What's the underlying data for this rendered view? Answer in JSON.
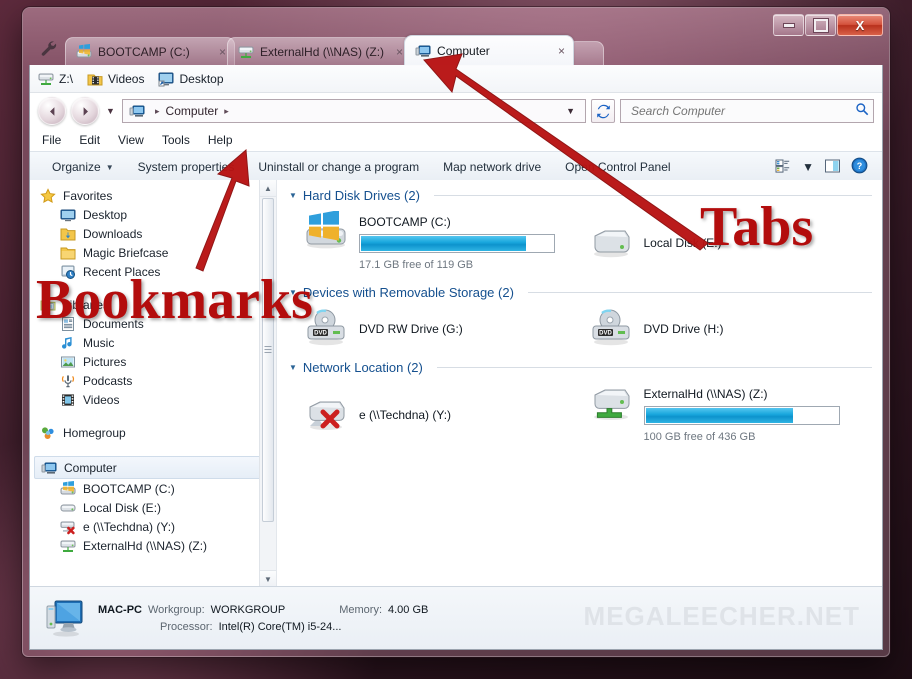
{
  "window": {
    "controls": {
      "minimize": "–",
      "maximize": "□",
      "close": "X"
    },
    "settings_icon": "wrench-icon"
  },
  "tabs": [
    {
      "label": "BOOTCAMP (C:)",
      "icon": "windows-drive-icon",
      "active": false,
      "close": "×"
    },
    {
      "label": "ExternalHd (\\\\NAS) (Z:)",
      "icon": "network-drive-icon",
      "active": false,
      "close": "×"
    },
    {
      "label": "Computer",
      "icon": "computer-icon",
      "active": true,
      "close": "×"
    }
  ],
  "bookmarks": [
    {
      "label": "Z:\\",
      "icon": "network-drive-icon"
    },
    {
      "label": "Videos",
      "icon": "videos-folder-icon"
    },
    {
      "label": "Desktop",
      "icon": "desktop-shortcut-icon"
    }
  ],
  "navigation": {
    "back": "◀",
    "forward": "▶",
    "history_dropdown": "▼",
    "breadcrumb": {
      "icon": "computer-icon",
      "root_sep": "▸",
      "path": "Computer",
      "trailing_sep": "▸",
      "dropdown": "▼"
    },
    "refresh": "↻",
    "refresh_icon": "refresh-icon"
  },
  "search": {
    "placeholder": "Search Computer",
    "value": "",
    "icon": "search-icon"
  },
  "menu": [
    "File",
    "Edit",
    "View",
    "Tools",
    "Help"
  ],
  "commandbar": {
    "items": [
      "Organize",
      "System properties",
      "Uninstall or change a program",
      "Map network drive",
      "Open Control Panel"
    ],
    "organize_caret": "▼",
    "view_caret": "▼",
    "icons": [
      "view-options-icon",
      "preview-pane-icon",
      "help-icon"
    ]
  },
  "sidebar": {
    "groups": [
      {
        "header": {
          "label": "Favorites",
          "icon": "favorites-star-icon"
        },
        "items": [
          {
            "label": "Desktop",
            "icon": "desktop-icon"
          },
          {
            "label": "Downloads",
            "icon": "downloads-folder-icon"
          },
          {
            "label": "Magic Briefcase",
            "icon": "folder-icon"
          },
          {
            "label": "Recent Places",
            "icon": "recent-places-icon"
          }
        ]
      },
      {
        "header": {
          "label": "Libraries",
          "icon": "libraries-icon"
        },
        "items": [
          {
            "label": "Documents",
            "icon": "documents-library-icon"
          },
          {
            "label": "Music",
            "icon": "music-library-icon"
          },
          {
            "label": "Pictures",
            "icon": "pictures-library-icon"
          },
          {
            "label": "Podcasts",
            "icon": "podcasts-library-icon"
          },
          {
            "label": "Videos",
            "icon": "videos-library-icon"
          }
        ]
      },
      {
        "header": {
          "label": "Homegroup",
          "icon": "homegroup-icon"
        },
        "items": []
      },
      {
        "header": {
          "label": "Computer",
          "icon": "computer-icon",
          "selected": true
        },
        "items": [
          {
            "label": "BOOTCAMP (C:)",
            "icon": "windows-drive-icon"
          },
          {
            "label": "Local Disk (E:)",
            "icon": "hard-disk-icon"
          },
          {
            "label": "e (\\\\Techdna) (Y:)",
            "icon": "disconnected-network-drive-icon"
          },
          {
            "label": "ExternalHd (\\\\NAS) (Z:)",
            "icon": "network-drive-icon"
          }
        ]
      }
    ],
    "scrollbar": {
      "up": "▲",
      "down": "▼"
    }
  },
  "content": {
    "groups": [
      {
        "title": "Hard Disk Drives (2)",
        "twisty": "▼",
        "items": [
          {
            "name": "BOOTCAMP (C:)",
            "icon": "windows-drive-icon",
            "has_bar": true,
            "free_text": "17.1 GB free of 119 GB",
            "used_percent": 86,
            "bar_color": "#19a7dd"
          },
          {
            "name": "Local Disk (E:)",
            "icon": "hard-disk-icon",
            "has_bar": false,
            "free_text": "",
            "used_percent": 0
          }
        ]
      },
      {
        "title": "Devices with Removable Storage (2)",
        "twisty": "▼",
        "items": [
          {
            "name": "DVD RW Drive (G:)",
            "icon": "dvd-rw-drive-icon",
            "has_bar": false,
            "free_text": "",
            "used_percent": 0
          },
          {
            "name": "DVD Drive (H:)",
            "icon": "dvd-drive-icon",
            "has_bar": false,
            "free_text": "",
            "used_percent": 0
          }
        ]
      },
      {
        "title": "Network Location (2)",
        "twisty": "▼",
        "items": [
          {
            "name": "e (\\\\Techdna) (Y:)",
            "icon": "disconnected-network-drive-icon",
            "has_bar": false,
            "free_text": "",
            "used_percent": 0
          },
          {
            "name": "ExternalHd (\\\\NAS) (Z:)",
            "icon": "network-drive-icon",
            "has_bar": true,
            "free_text": "100 GB free of 436 GB",
            "used_percent": 77,
            "bar_color": "#19a7dd"
          }
        ]
      }
    ]
  },
  "status": {
    "computer_name": "MAC-PC",
    "workgroup_label": "Workgroup:",
    "workgroup_value": "WORKGROUP",
    "memory_label": "Memory:",
    "memory_value": "4.00 GB",
    "processor_label": "Processor:",
    "processor_value": "Intel(R) Core(TM) i5-24...",
    "icon": "computer-icon",
    "watermark": "MEGALEECHER.NET"
  },
  "annotations": [
    {
      "text": "Bookmarks",
      "color": "#b30d0d"
    },
    {
      "text": "Tabs",
      "color": "#b30d0d"
    }
  ]
}
